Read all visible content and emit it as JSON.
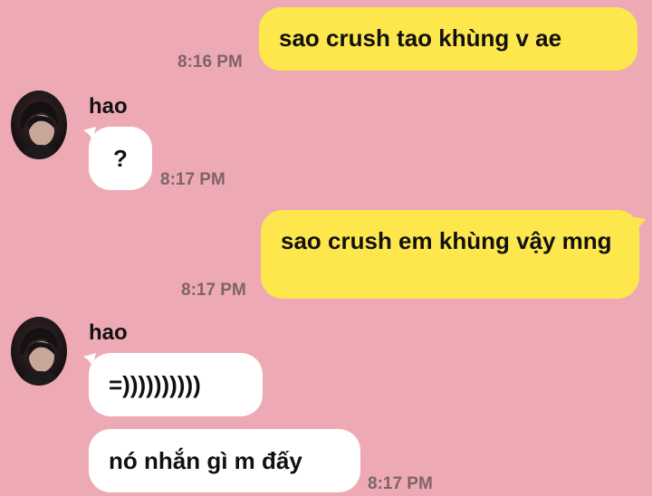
{
  "colors": {
    "background": "#eeaab4",
    "outgoing_bubble": "#fde74c",
    "incoming_bubble": "#ffffff",
    "timestamp": "#7d6468",
    "text": "#111111"
  },
  "messages": [
    {
      "direction": "outgoing",
      "text": "sao crush tao khùng v ae",
      "time": "8:16 PM"
    },
    {
      "direction": "incoming",
      "sender": "hao",
      "avatar_icon": "user-avatar-icon",
      "text": "?",
      "time": "8:17 PM"
    },
    {
      "direction": "outgoing",
      "text": "sao crush em khùng vậy mng",
      "time": "8:17 PM"
    },
    {
      "direction": "incoming",
      "sender": "hao",
      "avatar_icon": "user-avatar-icon",
      "text": "=))))))))))",
      "time": ""
    },
    {
      "direction": "incoming",
      "text": "nó nhắn gì m đấy",
      "time": "8:17 PM"
    }
  ]
}
